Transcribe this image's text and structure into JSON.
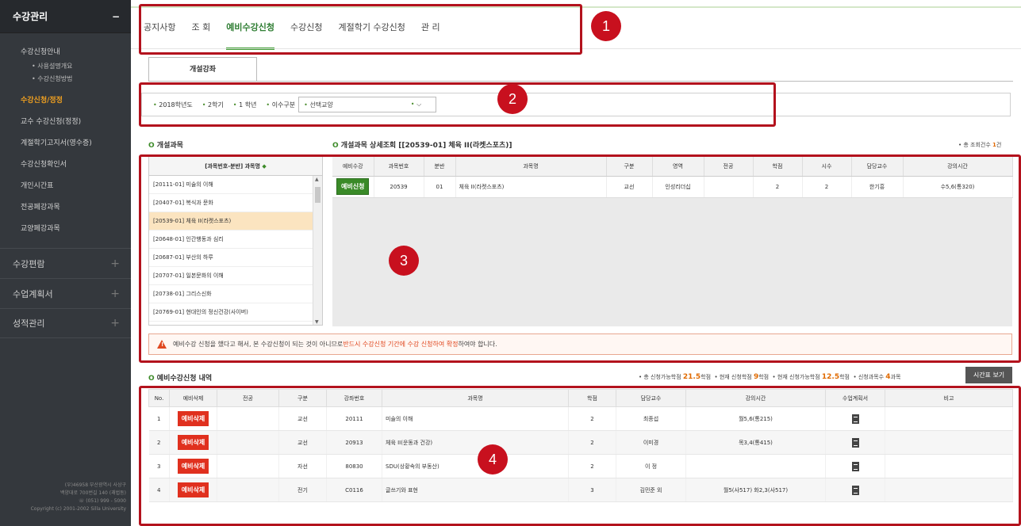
{
  "sidebar": {
    "menu_title": "수강관리",
    "menu_toggle": "−",
    "items": [
      {
        "label": "수강신청안내",
        "sub": [
          "• 사용설명개요",
          "• 수강신청방법"
        ]
      },
      {
        "label": "수강신청/정정",
        "active": true
      },
      {
        "label": "교수 수강신청(정정)"
      },
      {
        "label": "계절학기고지서(영수증)"
      },
      {
        "label": "수강신청확인서"
      },
      {
        "label": "개인시간표"
      },
      {
        "label": "전공폐강과목"
      },
      {
        "label": "교양폐강과목"
      }
    ],
    "groups": [
      {
        "label": "수강편람"
      },
      {
        "label": "수업계획서"
      },
      {
        "label": "성적관리"
      }
    ],
    "footer": [
      "(우)46958 부산광역시 사상구",
      "백양대로 700번길 140 (괘법동)",
      "☏ (051) 999 - 5000",
      "Copyright (c) 2001-2002 Silla University"
    ]
  },
  "nav": {
    "tabs": [
      "공지사항",
      "조 회",
      "예비수강신청",
      "수강신청",
      "계절학기 수강신청",
      "관 리"
    ],
    "active": 2
  },
  "callouts": [
    "1",
    "2",
    "3",
    "4"
  ],
  "subtab": "개설강좌",
  "filter": {
    "year": "2018학년도",
    "semester": "2학기",
    "grade": "1 학년",
    "type_label": "이수구분",
    "type_value": "선택교양"
  },
  "left_section": {
    "title": "개설과목",
    "list_header": "[과목번호-분반] 과목명",
    "star": "◆",
    "items": [
      "[20111-01] 미술의 이해",
      "[20407-01] 복식과 문화",
      "[20539-01] 체육 II(라켓스포츠)",
      "[20648-01] 인간행동과 심리",
      "[20687-01] 부산의 하루",
      "[20707-01] 일본문화의 이해",
      "[20738-01] 그리스신화",
      "[20769-01] 현대인의 정신건강(사이버)"
    ],
    "active": 2
  },
  "detail": {
    "title": "개설과목 상세조회 [[20539-01] 체육 II(라켓스포츠)]",
    "count_label": "총 조회건수",
    "count": "1",
    "count_unit": "건",
    "headers": [
      "예비수강",
      "과목번호",
      "분반",
      "과목명",
      "구분",
      "영역",
      "전공",
      "학점",
      "시수",
      "담당교수",
      "강의시간"
    ],
    "row": {
      "btn": "예비신청",
      "code": "20539",
      "section": "01",
      "name": "체육 II(라켓스포츠)",
      "type": "교선",
      "area": "인성리더십",
      "major": "",
      "credit": "2",
      "hours": "2",
      "prof": "한기흥",
      "time": "수5,6(통320)"
    }
  },
  "warning": {
    "pre": "예비수강 신청을 했다고 해서, 본 수강신청이 되는 것이 아니므로 ",
    "red": "반드시 수강신청 기간에 수강 신청하여 확정",
    "post": "하여야 합니다."
  },
  "history": {
    "title": "예비수강신청 내역",
    "stats": [
      {
        "label": "총 신청가능학점",
        "value": "21.5",
        "unit": "학점"
      },
      {
        "label": "현재 신청학점",
        "value": "9",
        "unit": "학점"
      },
      {
        "label": "현재 신청가능학점",
        "value": "12.5",
        "unit": "학점"
      },
      {
        "label": "신청과목수",
        "value": "4",
        "unit": "과목"
      }
    ],
    "timetable_btn": "시간표 보기",
    "headers": [
      "No.",
      "예비삭제",
      "전공",
      "구분",
      "강좌번호",
      "과목명",
      "학점",
      "담당교수",
      "강의시간",
      "수업계획서",
      "비고"
    ],
    "rows": [
      {
        "no": "1",
        "btn": "예비삭제",
        "major": "",
        "type": "교선",
        "code": "20111",
        "name": "미술의 이해",
        "credit": "2",
        "prof": "최종섭",
        "time": "월5,6(통215)",
        "note": ""
      },
      {
        "no": "2",
        "btn": "예비삭제",
        "major": "",
        "type": "교선",
        "code": "20913",
        "name": "체육 II(운동과 건강)",
        "credit": "2",
        "prof": "이미경",
        "time": "목3,4(통415)",
        "note": ""
      },
      {
        "no": "3",
        "btn": "예비삭제",
        "major": "",
        "type": "자선",
        "code": "80830",
        "name": "SDU(상황속의 부동산)",
        "credit": "2",
        "prof": "이 정",
        "time": "",
        "note": ""
      },
      {
        "no": "4",
        "btn": "예비삭제",
        "major": "",
        "type": "전기",
        "code": "C0116",
        "name": "글쓰기와 표현",
        "credit": "3",
        "prof": "김민준 외",
        "time": "월5(사517) 화2,3(사517)",
        "note": ""
      }
    ]
  }
}
